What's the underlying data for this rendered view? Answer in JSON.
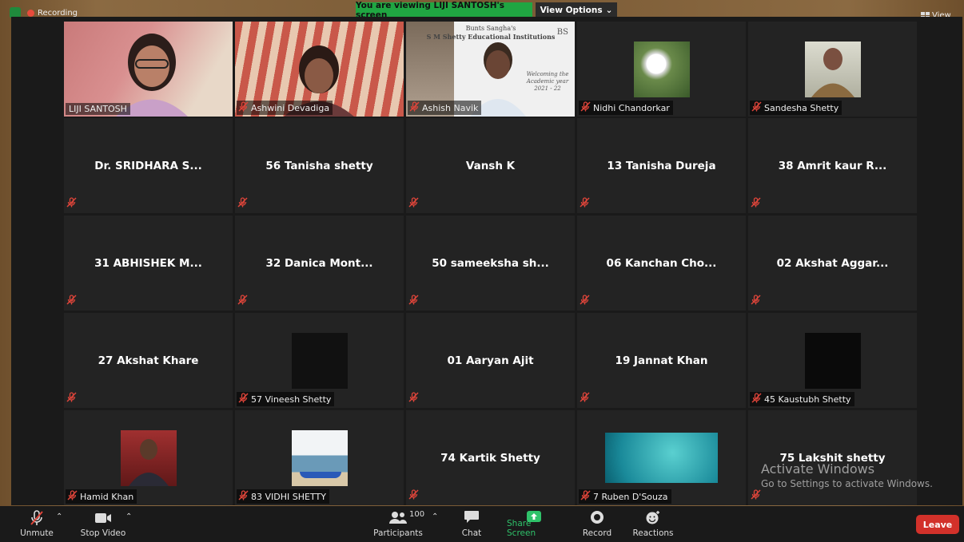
{
  "topbar": {
    "recording_label": "Recording",
    "banner_text": "You are viewing LIJI SANTOSH's screen",
    "view_options_label": "View Options",
    "view_label": "View"
  },
  "tiles": [
    {
      "name": "LIJI SANTOSH",
      "display": "video"
    },
    {
      "name": "Ashwini Devadiga",
      "display": "video"
    },
    {
      "name": "Ashish Navik",
      "display": "video"
    },
    {
      "name": "Nidhi Chandorkar",
      "display": "photo"
    },
    {
      "name": "Sandesha Shetty",
      "display": "photo"
    },
    {
      "name": "Dr. SRIDHARA S...",
      "display": "name"
    },
    {
      "name": "56 Tanisha shetty",
      "display": "name"
    },
    {
      "name": "Vansh K",
      "display": "name"
    },
    {
      "name": "13 Tanisha Dureja",
      "display": "name"
    },
    {
      "name": "38 Amrit kaur R...",
      "display": "name"
    },
    {
      "name": "31 ABHISHEK M...",
      "display": "name"
    },
    {
      "name": "32 Danica Mont...",
      "display": "name"
    },
    {
      "name": "50 sameeksha sh...",
      "display": "name"
    },
    {
      "name": "06 Kanchan Cho...",
      "display": "name"
    },
    {
      "name": "02 Akshat Aggar...",
      "display": "name"
    },
    {
      "name": "27 Akshat Khare",
      "display": "name"
    },
    {
      "name": "57 Vineesh Shetty",
      "display": "photo"
    },
    {
      "name": "01 Aaryan Ajit",
      "display": "name"
    },
    {
      "name": "19 Jannat Khan",
      "display": "name"
    },
    {
      "name": "45 Kaustubh Shetty",
      "display": "photo"
    },
    {
      "name": "Hamid Khan",
      "display": "photo"
    },
    {
      "name": "83 VIDHI SHETTY",
      "display": "photo"
    },
    {
      "name": "74 Kartik Shetty",
      "display": "name"
    },
    {
      "name": "7 Ruben D'Souza",
      "display": "photo"
    },
    {
      "name": "75 Lakshit shetty",
      "display": "name"
    }
  ],
  "tile_content": {
    "ashish_banner_line1": "Bunts Sangha's",
    "ashish_banner_line2": "S M Shetty Educational Institutions",
    "ashish_banner_welcome": "Welcoming the Academic year 2021 - 22",
    "ashish_banner_logo": "BS"
  },
  "watermark": {
    "line1": "Activate Windows",
    "line2": "Go to Settings to activate Windows."
  },
  "toolbar": {
    "unmute_label": "Unmute",
    "stop_video_label": "Stop Video",
    "participants_label": "Participants",
    "participants_count": "100",
    "chat_label": "Chat",
    "share_screen_label": "Share Screen",
    "record_label": "Record",
    "reactions_label": "Reactions",
    "leave_label": "Leave"
  },
  "colors": {
    "active_speaker_border": "#d2ea7a",
    "banner_green": "#20a642",
    "share_green": "#2fc26a",
    "leave_red": "#d2312a",
    "muted_red": "#e0453a"
  }
}
